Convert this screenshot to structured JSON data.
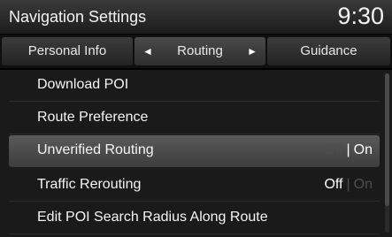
{
  "header": {
    "title": "Navigation Settings",
    "clock": "9:30"
  },
  "tabs": {
    "personal": "Personal Info",
    "routing": "Routing",
    "guidance": "Guidance",
    "arrow_left": "◄",
    "arrow_right": "►"
  },
  "menu": {
    "items": [
      {
        "label": "Download POI"
      },
      {
        "label": "Route Preference"
      },
      {
        "label": "Unverified Routing",
        "off": "Off",
        "sep": "|",
        "on": "On",
        "state": "On"
      },
      {
        "label": "Traffic Rerouting",
        "off": "Off",
        "sep": "|",
        "on": "On",
        "state": "Off"
      },
      {
        "label": "Edit POI Search Radius Along Route"
      }
    ]
  },
  "colors": {
    "selected_row": "#4c4c4c",
    "dim_text": "#4e4e4e",
    "text": "#ffffff"
  }
}
